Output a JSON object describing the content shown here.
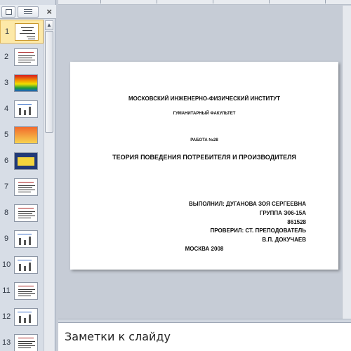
{
  "thumbnails_panel": {
    "close_glyph": "×",
    "slides": [
      {
        "number": "1",
        "style": "title",
        "selected": true
      },
      {
        "number": "2",
        "style": "text"
      },
      {
        "number": "3",
        "style": "rainbow"
      },
      {
        "number": "4",
        "style": "chart"
      },
      {
        "number": "5",
        "style": "sunset"
      },
      {
        "number": "6",
        "style": "navy"
      },
      {
        "number": "7",
        "style": "text"
      },
      {
        "number": "8",
        "style": "text"
      },
      {
        "number": "9",
        "style": "chart"
      },
      {
        "number": "10",
        "style": "chart"
      },
      {
        "number": "11",
        "style": "text"
      },
      {
        "number": "12",
        "style": "chart"
      },
      {
        "number": "13",
        "style": "text"
      }
    ],
    "scroll_up_glyph": "▲"
  },
  "slide": {
    "institute": "МОСКОВСКИЙ ИНЖЕНЕРНО-ФИЗИЧЕСКИЙ ИНСТИТУТ",
    "faculty": "ГУМАНИТАРНЫЙ ФАКУЛЬТЕТ",
    "work": "РАБОТА №28",
    "title": "ТЕОРИЯ ПОВЕДЕНИЯ ПОТРЕБИТЕЛЯ И ПРОИЗВОДИТЕЛЯ",
    "performed_by": "ВЫПОЛНИЛ: ДУГАНОВА ЗОЯ СЕРГЕЕВНА",
    "group": "ГРУППА Э06-15А",
    "id": "861528",
    "checked_by": "ПРОВЕРИЛ: СТ. ПРЕПОДОВАТЕЛЬ",
    "checker": "В.П. ДОКУЧАЕВ",
    "city_year": "МОСКВА 2008"
  },
  "notes": {
    "placeholder": "Заметки к слайду"
  }
}
